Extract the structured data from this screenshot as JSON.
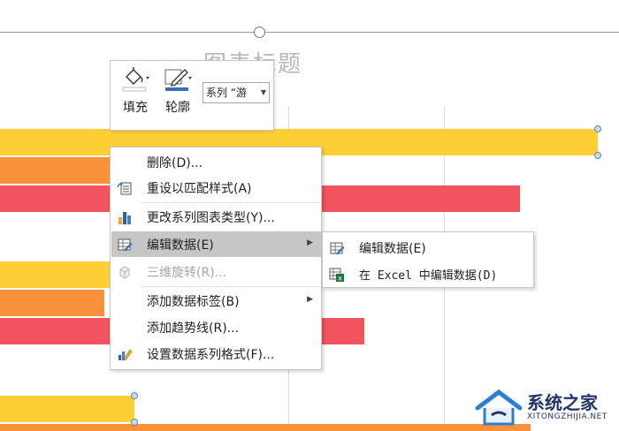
{
  "chart": {
    "title": "图表标题",
    "colors": {
      "yellow": "#fdcf35",
      "orange": "#f9913b",
      "red": "#f1545f",
      "handle": "#5a86b6"
    }
  },
  "mini_toolbar": {
    "fill_label": "填充",
    "outline_label": "轮廓",
    "series_selector": "系列 “游",
    "icons": [
      "paint-bucket-icon",
      "pen-outline-icon"
    ]
  },
  "context_menu": {
    "items": [
      {
        "label": "删除(D)...",
        "icon": "none",
        "enabled": true
      },
      {
        "label": "重设以匹配样式(A)",
        "icon": "reset-style-icon",
        "enabled": true
      },
      {
        "label": "更改系列图表类型(Y)...",
        "icon": "bar-chart-icon",
        "enabled": true
      },
      {
        "label": "编辑数据(E)",
        "icon": "edit-data-icon",
        "enabled": true,
        "submenu": true,
        "highlighted": true
      },
      {
        "label": "三维旋转(R)...",
        "icon": "3d-rotate-icon",
        "enabled": false
      },
      {
        "label": "添加数据标签(B)",
        "icon": "none",
        "enabled": true,
        "submenu": true
      },
      {
        "label": "添加趋势线(R)...",
        "icon": "none",
        "enabled": true
      },
      {
        "label": "设置数据系列格式(F)...",
        "icon": "format-series-icon",
        "enabled": true
      }
    ]
  },
  "submenu": {
    "items": [
      {
        "label": "编辑数据(E)",
        "icon": "edit-data-icon"
      },
      {
        "label": "在 Excel 中编辑数据(D)",
        "icon": "excel-icon"
      }
    ]
  },
  "watermark": {
    "title": "系统之家",
    "subtitle": "XITONGZHIJIA.NET"
  }
}
